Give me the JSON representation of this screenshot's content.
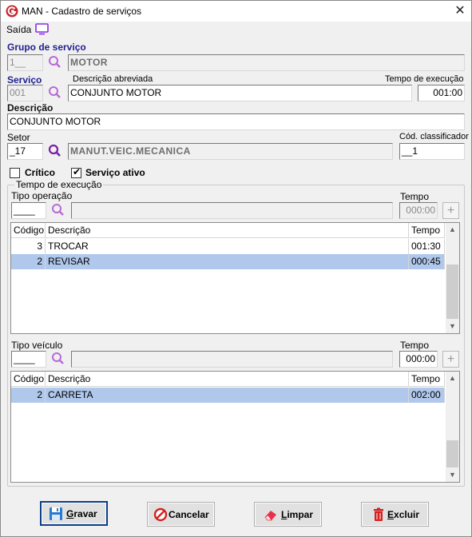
{
  "window": {
    "title": "MAN - Cadastro de serviços",
    "close_symbol": "✕"
  },
  "menu": {
    "exit_label": "Saída"
  },
  "grupo": {
    "label": "Grupo de serviço",
    "code": "1__",
    "name": "MOTOR"
  },
  "servico": {
    "label": "Serviço",
    "code": "001",
    "short_desc_label": "Descrição abreviada",
    "short_desc": "CONJUNTO MOTOR",
    "time_label": "Tempo de execução",
    "time": "001:00"
  },
  "descricao": {
    "label": "Descrição",
    "value": "CONJUNTO MOTOR"
  },
  "setor": {
    "label": "Setor",
    "code": "_17",
    "name": "MANUT.VEIC.MECANICA",
    "classifier_label": "Cód. classificador",
    "classifier": "__1"
  },
  "flags": {
    "critico_label": "Crítico",
    "critico_checked": false,
    "ativo_label": "Serviço ativo",
    "ativo_checked": true,
    "check_symbol": "✔"
  },
  "execucao": {
    "title": "Tempo de execução",
    "tipo_operacao_label": "Tipo operação",
    "tipo_operacao_code": "____",
    "tipo_operacao_desc": "",
    "tempo_label": "Tempo",
    "tempo_value": "000:00",
    "columns": [
      "Código",
      "Descrição",
      "Tempo"
    ],
    "rows": [
      {
        "code": "3",
        "desc": "TROCAR",
        "time": "001:30",
        "selected": false
      },
      {
        "code": "2",
        "desc": "REVISAR",
        "time": "000:45",
        "selected": true
      }
    ],
    "tipo_veiculo_label": "Tipo veículo",
    "tipo_veiculo_code": "____",
    "tipo_veiculo_desc": "",
    "tempo2_label": "Tempo",
    "tempo2_value": "000:00",
    "columns2": [
      "Código",
      "Descrição",
      "Tempo"
    ],
    "rows2": [
      {
        "code": "2",
        "desc": "CARRETA",
        "time": "002:00",
        "selected": true
      }
    ]
  },
  "buttons": {
    "gravar": "Gravar",
    "cancelar": "Cancelar",
    "limpar": "Limpar",
    "excluir": "Excluir"
  },
  "colors": {
    "accent_blue": "#1f1f8f",
    "selection": "#b0c8ec",
    "brand_red": "#c4262e",
    "monitor_icon": "#8a2be2"
  }
}
